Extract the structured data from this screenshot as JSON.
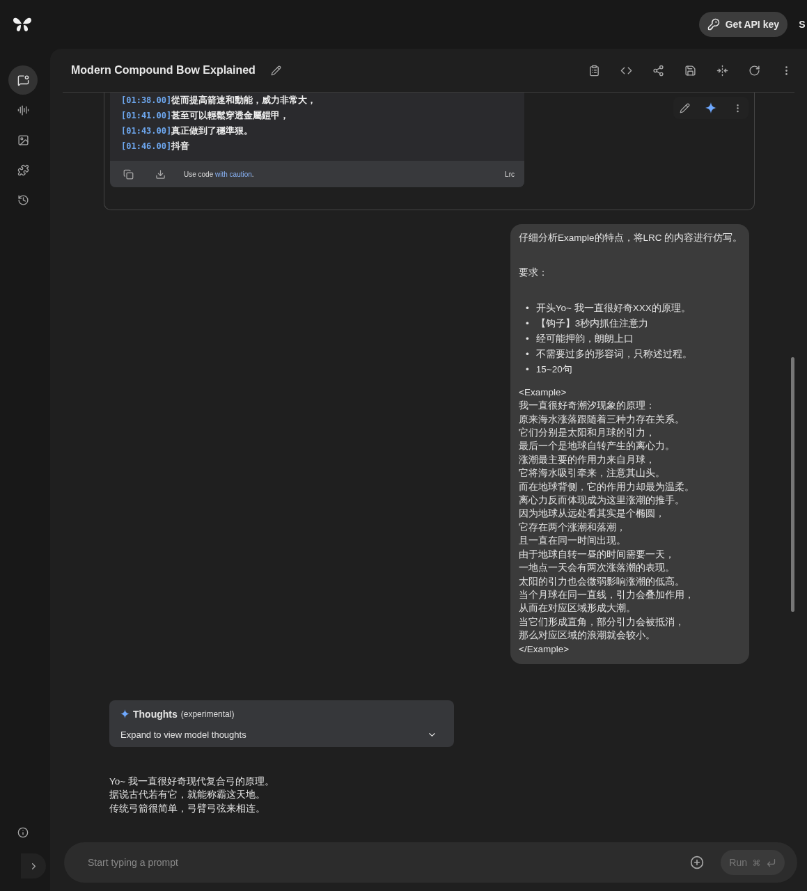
{
  "top_bar": {
    "api_button": "Get API key",
    "cut_button": "S"
  },
  "sidebar": {
    "items": [
      {
        "selected": true
      },
      {
        "selected": false
      },
      {
        "selected": false
      },
      {
        "selected": false
      },
      {
        "selected": false
      }
    ]
  },
  "header": {
    "title": "Modern Compound Bow Explained"
  },
  "code_block": {
    "lines": [
      {
        "time": "[01:38.00]",
        "text": "從而提高箭速和動能，威力非常大，"
      },
      {
        "time": "[01:41.00]",
        "text": "甚至可以輕鬆穿透金屬鎧甲，"
      },
      {
        "time": "[01:43.00]",
        "text": "真正做到了穩準狠。"
      },
      {
        "time": "[01:46.00]",
        "text": "抖音"
      }
    ],
    "notice": {
      "before": "Use code ",
      "link": "with caution",
      "after": "."
    },
    "language": "Lrc"
  },
  "user_message": {
    "intro": "仔细分析Example的特点，将LRC 的内容进行仿写。",
    "heading": "要求：",
    "bullets": [
      {
        "marker": "•",
        "text": "开头Yo~ 我一直很好奇XXX的原理。"
      },
      {
        "marker": "•",
        "text": "【钩子】3秒内抓住注意力"
      },
      {
        "marker": "•",
        "text": "经可能押韵，朗朗上口"
      },
      {
        "marker": "•",
        "text": "不需要过多的形容词，只称述过程。"
      },
      {
        "marker": "•",
        "text": "15~20句"
      }
    ],
    "example": [
      "<Example>",
      "我一直很好奇潮汐现象的原理：",
      "原来海水涨落跟随着三种力存在关系。",
      "它们分别是太阳和月球的引力，",
      "最后一个是地球自转产生的离心力。",
      "涨潮最主要的作用力来自月球，",
      "它将海水吸引牵来，注意其山头。",
      "而在地球背侧，它的作用力却最为温柔。",
      "离心力反而体现成为这里涨潮的推手。",
      "因为地球从远处看其实是个椭圆，",
      "它存在两个涨潮和落潮，",
      "且一直在同一时间出现。",
      "由于地球自转一昼的时间需要一天，",
      "一地点一天会有两次涨落潮的表现。",
      "太阳的引力也会微弱影响涨潮的低高。",
      "当个月球在同一直线，引力会叠加作用，",
      "从而在对应区域形成大潮。",
      "当它们形成直角，部分引力会被抵消，",
      "那么对应区域的浪潮就会较小。",
      "</Example>"
    ]
  },
  "thoughts": {
    "title": "Thoughts",
    "tag": "(experimental)",
    "expander": "Expand to view model thoughts",
    "expanded": false
  },
  "response": {
    "lines": [
      "Yo~ 我一直很好奇现代复合弓的原理。",
      "据说古代若有它，就能称霸这天地。",
      "传统弓箭很简单，弓臂弓弦来相连。"
    ]
  },
  "prompt": {
    "placeholder": "Start typing a prompt",
    "run_button": "Run",
    "run_disabled": true
  }
}
